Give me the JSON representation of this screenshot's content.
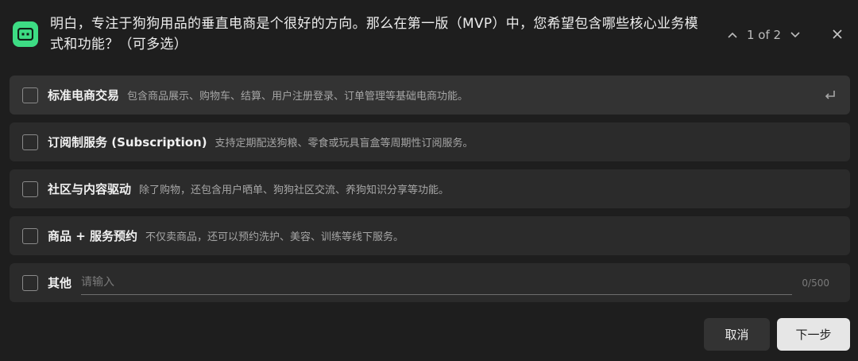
{
  "header": {
    "question": "明白，专注于狗狗用品的垂直电商是个很好的方向。那么在第一版（MVP）中，您希望包含哪些核心业务模式和功能？（可多选）",
    "pager": "1 of 2"
  },
  "options": [
    {
      "title": "标准电商交易",
      "desc": "包含商品展示、购物车、结算、用户注册登录、订单管理等基础电商功能。"
    },
    {
      "title": "订阅制服务 (Subscription)",
      "desc": "支持定期配送狗粮、零食或玩具盲盒等周期性订阅服务。"
    },
    {
      "title": "社区与内容驱动",
      "desc": "除了购物，还包含用户晒单、狗狗社区交流、养狗知识分享等功能。"
    },
    {
      "title": "商品 + 服务预约",
      "desc": "不仅卖商品，还可以预约洗护、美容、训练等线下服务。"
    }
  ],
  "other": {
    "title": "其他",
    "placeholder": "请输入",
    "value": "",
    "counter": "0/500"
  },
  "buttons": {
    "cancel": "取消",
    "next": "下一步"
  },
  "colors": {
    "accent": "#3ddc84",
    "background": "#1e1e1e",
    "option_bg": "#2b2b2b"
  },
  "icons": {
    "header": "bot-chat-icon",
    "prev": "chevron-up-icon",
    "next": "chevron-down-icon",
    "close": "close-icon",
    "enter": "enter-return-icon"
  }
}
